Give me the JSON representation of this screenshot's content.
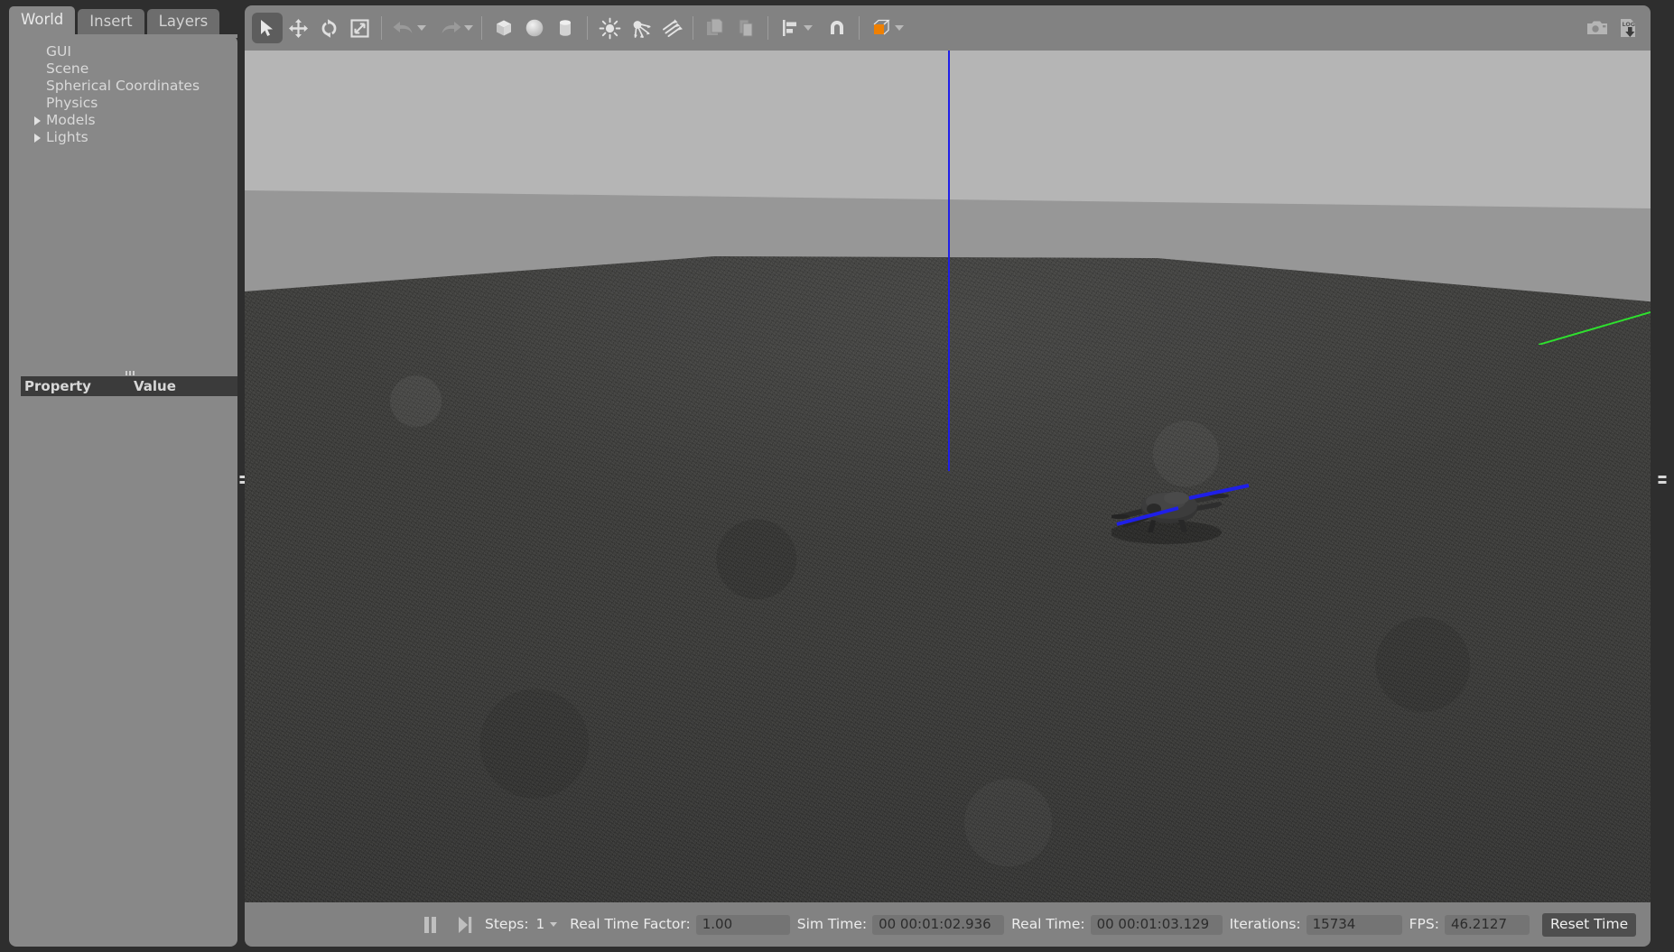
{
  "app": {
    "title": "Gazebo",
    "accent_orange": "#f08000",
    "panel_bg": "#888888",
    "toolbar_bg": "#828282",
    "frame_bg": "#2e2e2e"
  },
  "left_panel": {
    "tabs": [
      {
        "label": "World",
        "active": true
      },
      {
        "label": "Insert",
        "active": false
      },
      {
        "label": "Layers",
        "active": false
      }
    ],
    "tree": [
      {
        "label": "GUI",
        "expandable": false
      },
      {
        "label": "Scene",
        "expandable": false
      },
      {
        "label": "Spherical Coordinates",
        "expandable": false
      },
      {
        "label": "Physics",
        "expandable": false
      },
      {
        "label": "Models",
        "expandable": true
      },
      {
        "label": "Lights",
        "expandable": true
      }
    ],
    "property_table": {
      "col_property": "Property",
      "col_value": "Value",
      "rows": []
    }
  },
  "toolbar": {
    "items": [
      {
        "name": "select-icon",
        "active": true
      },
      {
        "name": "translate-icon",
        "active": false
      },
      {
        "name": "rotate-icon",
        "active": false
      },
      {
        "name": "scale-icon",
        "active": false
      },
      {
        "name": "undo-icon",
        "active": false
      },
      {
        "name": "redo-icon",
        "active": false
      },
      {
        "name": "box-icon",
        "active": false
      },
      {
        "name": "sphere-icon",
        "active": false
      },
      {
        "name": "cylinder-icon",
        "active": false
      },
      {
        "name": "point-light-icon",
        "active": false
      },
      {
        "name": "spot-light-icon",
        "active": false
      },
      {
        "name": "directional-light-icon",
        "active": false
      },
      {
        "name": "copy-icon",
        "active": false
      },
      {
        "name": "paste-icon",
        "active": false
      },
      {
        "name": "align-icon",
        "active": false
      },
      {
        "name": "snap-icon",
        "active": false
      },
      {
        "name": "view-mode-icon",
        "active": false
      },
      {
        "name": "screenshot-icon",
        "active": false
      },
      {
        "name": "log-record-icon",
        "active": false
      }
    ]
  },
  "viewport": {
    "scene_name": "quadcopter-on-asphalt-ground",
    "sky_color": "#b5b5b5",
    "fog_color": "#979797",
    "ground_color": "#3a3a38",
    "axis_blue_color": "#1f1fe8",
    "axis_green_color": "#2ee02e",
    "model_name": "drone"
  },
  "status_bar": {
    "pause_label": "pause",
    "step_label": "step",
    "steps_label": "Steps:",
    "steps_value": "1",
    "real_time_factor_label": "Real Time Factor:",
    "real_time_factor_value": "1.00",
    "sim_time_label": "Sim Time:",
    "sim_time_value": "00 00:01:02.936",
    "real_time_label": "Real Time:",
    "real_time_value": "00 00:01:03.129",
    "iterations_label": "Iterations:",
    "iterations_value": "15734",
    "fps_label": "FPS:",
    "fps_value": "46.2127",
    "reset_time_label": "Reset Time"
  }
}
